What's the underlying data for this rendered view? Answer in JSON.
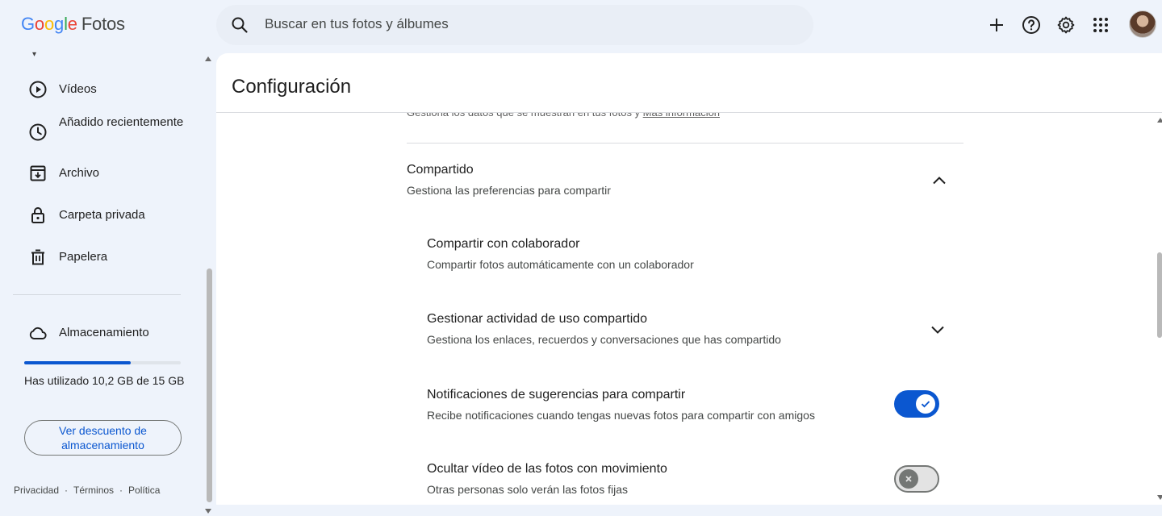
{
  "app": {
    "logo_google": [
      "G",
      "o",
      "o",
      "g",
      "l",
      "e"
    ],
    "logo_product": "Fotos"
  },
  "search": {
    "placeholder": "Buscar en tus fotos y álbumes",
    "icon": "search-icon"
  },
  "top_actions": [
    {
      "name": "add-button",
      "icon": "plus-icon"
    },
    {
      "name": "help-button",
      "icon": "help-circle-icon"
    },
    {
      "name": "settings-button",
      "icon": "gear-icon"
    },
    {
      "name": "apps-button",
      "icon": "grid-dots-icon"
    }
  ],
  "sidebar": {
    "items": [
      {
        "label": "Vídeos",
        "icon": "play-circle-icon"
      },
      {
        "label": "Añadido recientemente",
        "icon": "clock-icon"
      },
      {
        "label": "Archivo",
        "icon": "archive-icon"
      },
      {
        "label": "Carpeta privada",
        "icon": "lock-icon"
      },
      {
        "label": "Papelera",
        "icon": "trash-icon"
      }
    ],
    "storage": {
      "label": "Almacenamiento",
      "icon": "cloud-icon",
      "used_fraction": 0.68,
      "text": "Has utilizado 10,2 GB de 15 GB",
      "button": "Ver descuento de almacenamiento"
    },
    "footer": [
      "Privacidad",
      "Términos",
      "Política"
    ]
  },
  "main": {
    "title": "Configuración",
    "cut_text": "Gestiona los datos que se muestran en tus fotos y ",
    "cut_link": "Más información",
    "section": {
      "title": "Compartido",
      "subtitle": "Gestiona las preferencias para compartir",
      "expanded": true
    },
    "rows": [
      {
        "title": "Compartir con colaborador",
        "subtitle": "Compartir fotos automáticamente con un colaborador",
        "control": "none"
      },
      {
        "title": "Gestionar actividad de uso compartido",
        "subtitle": "Gestiona los enlaces, recuerdos y conversaciones que has compartido",
        "control": "chevron"
      },
      {
        "title": "Notificaciones de sugerencias para compartir",
        "subtitle": "Recibe notificaciones cuando tengas nuevas fotos para compartir con amigos",
        "control": "toggle",
        "enabled": true
      },
      {
        "title": "Ocultar vídeo de las fotos con movimiento",
        "subtitle": "Otras personas solo verán las fotos fijas",
        "control": "toggle",
        "enabled": false
      }
    ]
  },
  "colors": {
    "accent": "#0b57d0",
    "background": "#eef3fb",
    "panel": "#ffffff"
  }
}
